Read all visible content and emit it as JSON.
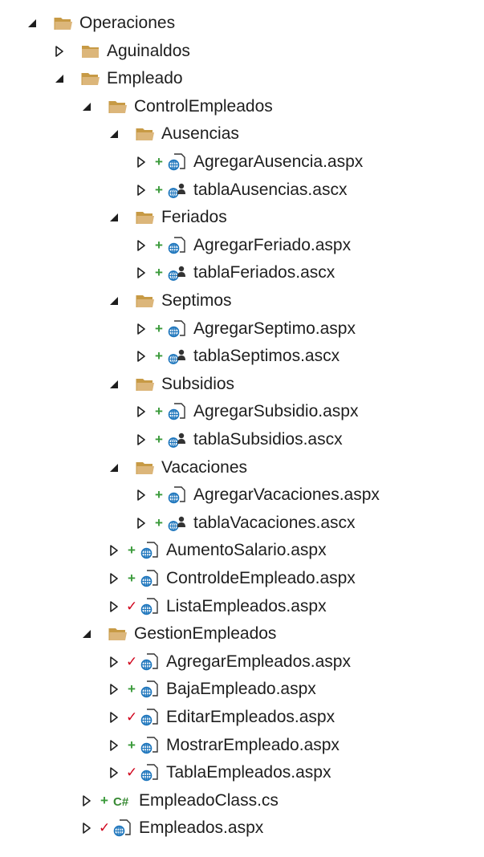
{
  "colors": {
    "folder_fill": "#dcb67a",
    "folder_dark": "#c79a45",
    "file_blue": "#1c75bc",
    "add_green": "#3a9a3a",
    "check_red": "#d0021b",
    "csharp_green": "#388a34"
  },
  "tree": [
    {
      "label": "Operaciones",
      "level": 0,
      "expander": "expanded",
      "icon": "folder-open-icon",
      "status": null
    },
    {
      "label": "Aguinaldos",
      "level": 1,
      "expander": "collapsed",
      "icon": "folder-closed-icon",
      "status": null
    },
    {
      "label": "Empleado",
      "level": 1,
      "expander": "expanded",
      "icon": "folder-open-icon",
      "status": null
    },
    {
      "label": "ControlEmpleados",
      "level": 2,
      "expander": "expanded",
      "icon": "folder-open-icon",
      "status": null
    },
    {
      "label": "Ausencias",
      "level": 3,
      "expander": "expanded",
      "icon": "folder-open-icon",
      "status": null
    },
    {
      "label": "AgregarAusencia.aspx",
      "level": 4,
      "expander": "collapsed",
      "icon": "aspx-page-icon",
      "status": "+"
    },
    {
      "label": "tablaAusencias.ascx",
      "level": 4,
      "expander": "collapsed",
      "icon": "user-control-icon",
      "status": "+"
    },
    {
      "label": "Feriados",
      "level": 3,
      "expander": "expanded",
      "icon": "folder-open-icon",
      "status": null
    },
    {
      "label": "AgregarFeriado.aspx",
      "level": 4,
      "expander": "collapsed",
      "icon": "aspx-page-icon",
      "status": "+"
    },
    {
      "label": "tablaFeriados.ascx",
      "level": 4,
      "expander": "collapsed",
      "icon": "user-control-icon",
      "status": "+"
    },
    {
      "label": "Septimos",
      "level": 3,
      "expander": "expanded",
      "icon": "folder-open-icon",
      "status": null
    },
    {
      "label": "AgregarSeptimo.aspx",
      "level": 4,
      "expander": "collapsed",
      "icon": "aspx-page-icon",
      "status": "+"
    },
    {
      "label": "tablaSeptimos.ascx",
      "level": 4,
      "expander": "collapsed",
      "icon": "user-control-icon",
      "status": "+"
    },
    {
      "label": "Subsidios",
      "level": 3,
      "expander": "expanded",
      "icon": "folder-open-icon",
      "status": null
    },
    {
      "label": "AgregarSubsidio.aspx",
      "level": 4,
      "expander": "collapsed",
      "icon": "aspx-page-icon",
      "status": "+"
    },
    {
      "label": "tablaSubsidios.ascx",
      "level": 4,
      "expander": "collapsed",
      "icon": "user-control-icon",
      "status": "+"
    },
    {
      "label": "Vacaciones",
      "level": 3,
      "expander": "expanded",
      "icon": "folder-open-icon",
      "status": null
    },
    {
      "label": "AgregarVacaciones.aspx",
      "level": 4,
      "expander": "collapsed",
      "icon": "aspx-page-icon",
      "status": "+"
    },
    {
      "label": "tablaVacaciones.ascx",
      "level": 4,
      "expander": "collapsed",
      "icon": "user-control-icon",
      "status": "+"
    },
    {
      "label": "AumentoSalario.aspx",
      "level": 3,
      "expander": "collapsed",
      "icon": "aspx-page-icon",
      "status": "+"
    },
    {
      "label": "ControldeEmpleado.aspx",
      "level": 3,
      "expander": "collapsed",
      "icon": "aspx-page-icon",
      "status": "+"
    },
    {
      "label": "ListaEmpleados.aspx",
      "level": 3,
      "expander": "collapsed",
      "icon": "aspx-page-icon",
      "status": "✓"
    },
    {
      "label": "GestionEmpleados",
      "level": 2,
      "expander": "expanded",
      "icon": "folder-open-icon",
      "status": null
    },
    {
      "label": "AgregarEmpleados.aspx",
      "level": 3,
      "expander": "collapsed",
      "icon": "aspx-page-icon",
      "status": "✓"
    },
    {
      "label": "BajaEmpleado.aspx",
      "level": 3,
      "expander": "collapsed",
      "icon": "aspx-page-icon",
      "status": "+"
    },
    {
      "label": "EditarEmpleados.aspx",
      "level": 3,
      "expander": "collapsed",
      "icon": "aspx-page-icon",
      "status": "✓"
    },
    {
      "label": "MostrarEmpleado.aspx",
      "level": 3,
      "expander": "collapsed",
      "icon": "aspx-page-icon",
      "status": "+"
    },
    {
      "label": "TablaEmpleados.aspx",
      "level": 3,
      "expander": "collapsed",
      "icon": "aspx-page-icon",
      "status": "✓"
    },
    {
      "label": "EmpleadoClass.cs",
      "level": 2,
      "expander": "collapsed",
      "icon": "csharp-file-icon",
      "status": "+"
    },
    {
      "label": "Empleados.aspx",
      "level": 2,
      "expander": "collapsed",
      "icon": "aspx-page-icon",
      "status": "✓"
    }
  ]
}
